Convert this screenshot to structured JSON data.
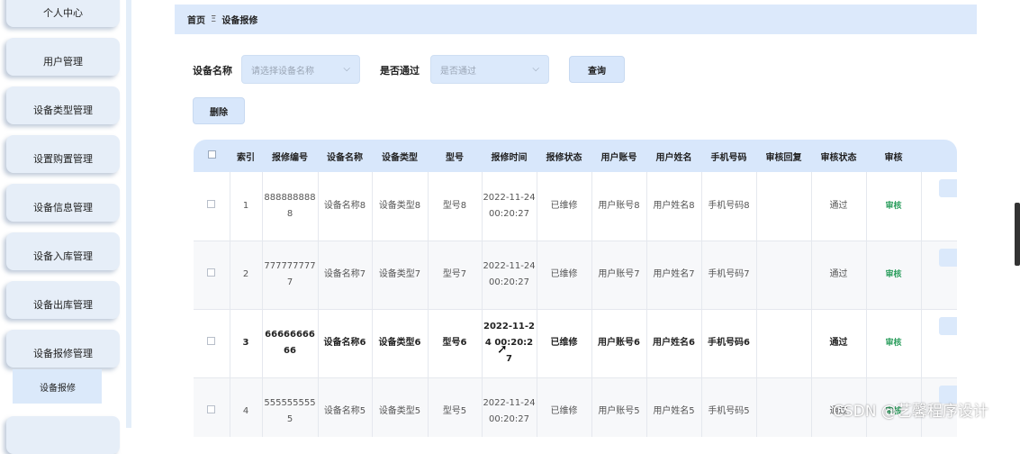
{
  "sidebar": {
    "items": [
      {
        "label": "个人中心"
      },
      {
        "label": "用户管理"
      },
      {
        "label": "设备类型管理"
      },
      {
        "label": "设置购置管理"
      },
      {
        "label": "设备信息管理"
      },
      {
        "label": "设备入库管理"
      },
      {
        "label": "设备出库管理"
      },
      {
        "label": "设备报修管理"
      }
    ],
    "sub_item": {
      "label": "设备报修"
    }
  },
  "breadcrumb": {
    "home": "首页",
    "separator": "Ξ",
    "current": "设备报修"
  },
  "filters": {
    "device_name_label": "设备名称",
    "device_name_placeholder": "请选择设备名称",
    "passed_label": "是否通过",
    "passed_placeholder": "是否通过",
    "query_button": "查询"
  },
  "actions": {
    "delete_button": "删除"
  },
  "table": {
    "headers": [
      "索引",
      "报修编号",
      "设备名称",
      "设备类型",
      "型号",
      "报修时间",
      "报修状态",
      "用户账号",
      "用户姓名",
      "手机号码",
      "审核回复",
      "审核状态",
      "审核"
    ],
    "rows": [
      {
        "index": "1",
        "repair_no": "8888888888",
        "device_name": "设备名称8",
        "device_type": "设备类型8",
        "model": "型号8",
        "repair_time": "2022-11-24 00:20:27",
        "repair_status": "已维修",
        "account": "用户账号8",
        "user_name": "用户姓名8",
        "phone": "手机号码8",
        "reply": "",
        "audit_status": "通过",
        "audit_action": "审核"
      },
      {
        "index": "2",
        "repair_no": "7777777777",
        "device_name": "设备名称7",
        "device_type": "设备类型7",
        "model": "型号7",
        "repair_time": "2022-11-24 00:20:27",
        "repair_status": "已维修",
        "account": "用户账号7",
        "user_name": "用户姓名7",
        "phone": "手机号码7",
        "reply": "",
        "audit_status": "通过",
        "audit_action": "审核"
      },
      {
        "index": "3",
        "repair_no": "6666666666",
        "device_name": "设备名称6",
        "device_type": "设备类型6",
        "model": "型号6",
        "repair_time": "2022-11-24 00:20:27",
        "repair_status": "已维修",
        "account": "用户账号6",
        "user_name": "用户姓名6",
        "phone": "手机号码6",
        "reply": "",
        "audit_status": "通过",
        "audit_action": "审核"
      },
      {
        "index": "4",
        "repair_no": "5555555555",
        "device_name": "设备名称5",
        "device_type": "设备类型5",
        "model": "型号5",
        "repair_time": "2022-11-24 00:20:27",
        "repair_status": "已维修",
        "account": "用户账号5",
        "user_name": "用户姓名5",
        "phone": "手机号码5",
        "reply": "",
        "audit_status": "通过",
        "audit_action": "审核"
      }
    ]
  },
  "watermark": "CSDN @艺馨程序设计",
  "colors": {
    "accent": "#d8e7fb",
    "audit_link": "#2a9d5c"
  }
}
